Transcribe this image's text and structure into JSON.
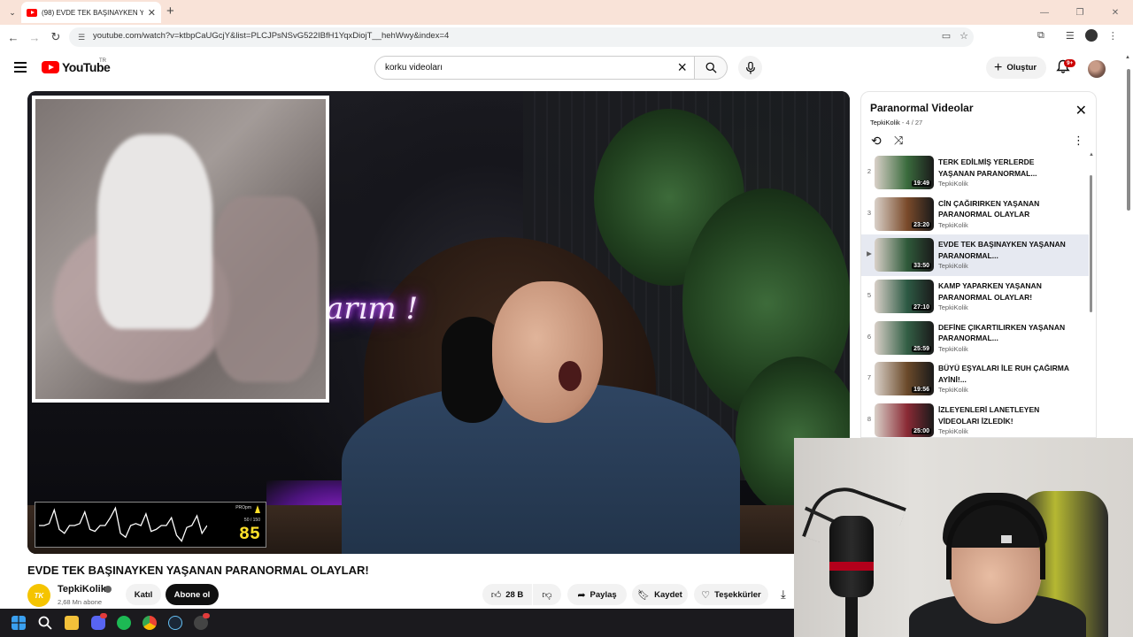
{
  "browser": {
    "tab_title": "(98) EVDE TEK BAŞINAYKEN YA...",
    "url": "youtube.com/watch?v=ktbpCaUGcjY&list=PLCJPsNSvG522IBfH1YqxDiojT__hehWwy&index=4"
  },
  "header": {
    "logo_text": "YouTube",
    "country": "TR",
    "search_value": "korku videoları",
    "create_label": "Oluştur",
    "notifications_badge": "9+"
  },
  "video": {
    "title": "EVDE TEK BAŞINAYKEN YAŞANAN PARANORMAL OLAYLAR!",
    "overlay_sign": "arım !",
    "heart_rate": "85",
    "heart_rate_label": "PROpm",
    "heart_rate_range": "50 / 150",
    "heart_rate_trace": [
      0.5,
      0.5,
      0.45,
      0.1,
      0.6,
      0.7,
      0.5,
      0.5,
      0.45,
      0.15,
      0.6,
      0.65,
      0.5,
      0.5,
      0.3,
      0.05,
      0.7,
      0.8,
      0.5,
      0.45,
      0.5,
      0.2,
      0.65,
      0.6,
      0.5,
      0.5,
      0.3,
      0.75,
      0.9,
      0.55,
      0.5,
      0.25,
      0.7,
      0.5
    ]
  },
  "channel": {
    "avatar_text": "TK",
    "name": "TepkiKolik",
    "subscribers": "2,68 Mn abone",
    "join_label": "Katıl",
    "subscribe_label": "Abone ol"
  },
  "actions": {
    "likes": "28 B",
    "share": "Paylaş",
    "save": "Kaydet",
    "thanks": "Teşekkürler"
  },
  "playlist": {
    "title": "Paranormal Videolar",
    "owner": "TepkiKolik",
    "position": "4 / 27",
    "items": [
      {
        "index": "2",
        "title": "TERK EDİLMİŞ YERLERDE YAŞANAN PARANORMAL...",
        "channel": "TepkiKolik",
        "duration": "19:49",
        "current": false,
        "thumb_color": "#3a6b3d"
      },
      {
        "index": "3",
        "title": "CİN ÇAĞIRIRKEN YAŞANAN PARANORMAL OLAYLAR",
        "channel": "TepkiKolik",
        "duration": "23:20",
        "current": false,
        "thumb_color": "#7a4a2a"
      },
      {
        "index": "▶",
        "title": "EVDE TEK BAŞINAYKEN YAŞANAN PARANORMAL...",
        "channel": "TepkiKolik",
        "duration": "33:50",
        "current": true,
        "thumb_color": "#2f5a3a"
      },
      {
        "index": "5",
        "title": "KAMP YAPARKEN YAŞANAN PARANORMAL OLAYLAR!",
        "channel": "TepkiKolik",
        "duration": "27:10",
        "current": false,
        "thumb_color": "#2d5a44"
      },
      {
        "index": "6",
        "title": "DEFİNE ÇIKARTILIRKEN YAŞANAN PARANORMAL...",
        "channel": "TepkiKolik",
        "duration": "25:59",
        "current": false,
        "thumb_color": "#335f45"
      },
      {
        "index": "7",
        "title": "BÜYÜ EŞYALARI İLE RUH ÇAĞIRMA AYİNİ!...",
        "channel": "TepkiKolik",
        "duration": "19:56",
        "current": false,
        "thumb_color": "#6b4a2a"
      },
      {
        "index": "8",
        "title": "İZLEYENLERİ LANETLEYEN VİDEOLARI İZLEDİK!",
        "channel": "TepkiKolik",
        "duration": "25:00",
        "current": false,
        "thumb_color": "#8a2a35"
      }
    ]
  }
}
